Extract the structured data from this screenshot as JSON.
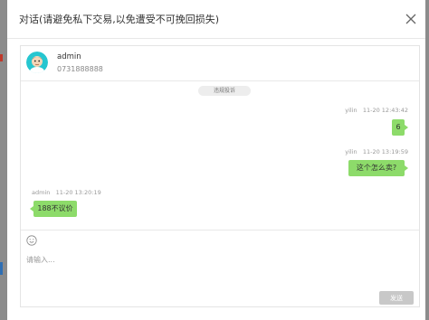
{
  "dialog": {
    "title": "对话(请避免私下交易,以免遭受不可挽回损失)",
    "close_icon": "close-icon"
  },
  "contact": {
    "name": "admin",
    "phone": "0731888888",
    "avatar_icon": "avatar-cartoon-icon"
  },
  "report_label": "违规投诉",
  "messages": [
    {
      "side": "right",
      "sender": "yilin",
      "time": "11-20 12:43:42",
      "text": "6"
    },
    {
      "side": "right",
      "sender": "yilin",
      "time": "11-20 13:19:59",
      "text": "这个怎么卖?"
    },
    {
      "side": "left",
      "sender": "admin",
      "time": "11-20 13:20:19",
      "text": "188不议价"
    }
  ],
  "composer": {
    "emoji_icon": "emoji-icon",
    "placeholder": "请输入...",
    "value": "",
    "send_label": "发送"
  },
  "colors": {
    "bubble": "#8ddb6a",
    "send_disabled": "#c8c8c8",
    "overlay": "#8c8c8c"
  }
}
